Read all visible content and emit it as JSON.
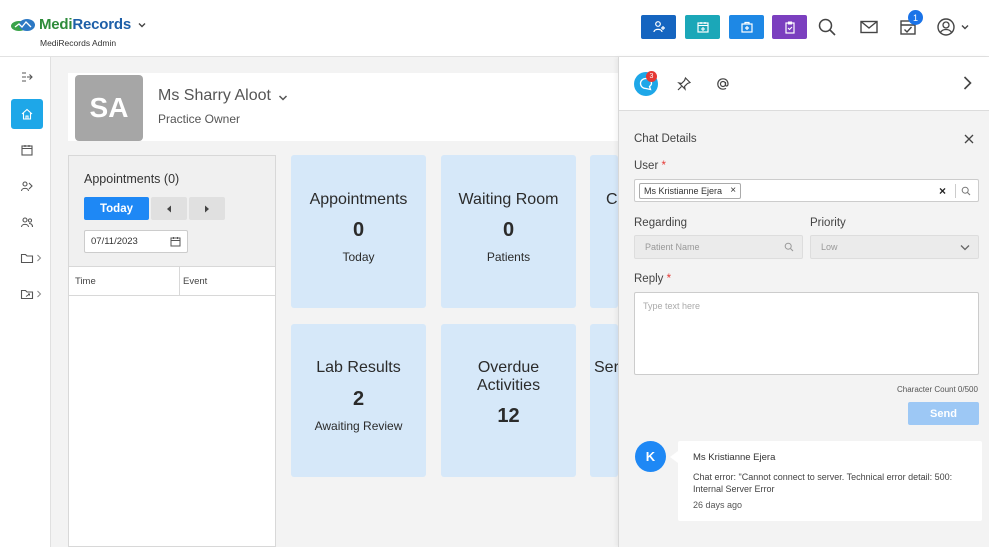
{
  "app": {
    "brand_part1": "Medi",
    "brand_part2": "Records",
    "subtitle": "MediRecords Admin",
    "brand_colors": {
      "green": "#2e8b3a",
      "blue": "#1d5fa8"
    }
  },
  "toolbar": {
    "quick_actions": [
      {
        "icon": "add-patient-icon",
        "color": "#1565c0"
      },
      {
        "icon": "calendar-add-icon",
        "color": "#1ba7b8"
      },
      {
        "icon": "medical-kit-icon",
        "color": "#1e88e5"
      },
      {
        "icon": "clipboard-icon",
        "color": "#7b3fbf"
      }
    ],
    "icons": [
      "search-icon",
      "mail-icon",
      "tasks-icon",
      "user-account-icon"
    ],
    "notification_count": "1"
  },
  "sidebar": {
    "items": [
      "expand-icon",
      "home-icon",
      "calendar-icon",
      "patients-icon",
      "contacts-icon",
      "folder-icon",
      "folder-share-icon"
    ],
    "active": "home-icon"
  },
  "profile": {
    "initials": "SA",
    "name": "Ms Sharry Aloot",
    "role": "Practice Owner"
  },
  "appointments": {
    "title": "Appointments (0)",
    "today_label": "Today",
    "date_value": "07/11/2023",
    "columns": [
      "Time",
      "Event"
    ]
  },
  "tiles": [
    {
      "title": "Appointments",
      "value": "0",
      "sub": "Today"
    },
    {
      "title": "Waiting Room",
      "value": "0",
      "sub": "Patients"
    },
    {
      "title": "Co",
      "value": "",
      "sub": ""
    },
    {
      "title": "Lab Results",
      "value": "2",
      "sub": "Awaiting Review"
    },
    {
      "title_line1": "Overdue",
      "title_line2": "Activities",
      "value": "12"
    },
    {
      "title": "Ser",
      "value": "",
      "sub": ""
    }
  ],
  "chat": {
    "unread_count": "3",
    "header": "Chat Details",
    "user_label": "User",
    "required_mark": "*",
    "selected_user": "Ms Kristianne Ejera",
    "chip_remove": "×",
    "clear_symbol": "×",
    "regarding_label": "Regarding",
    "regarding_placeholder": "Patient Name",
    "priority_label": "Priority",
    "priority_value": "Low",
    "reply_label": "Reply",
    "reply_placeholder": "Type text here",
    "char_count": "Character Count 0/500",
    "send_label": "Send",
    "message": {
      "avatar": "K",
      "author": "Ms Kristianne Ejera",
      "text": "Chat error: \"Cannot connect to server. Technical error detail: 500: Internal Server Error",
      "time": "26 days ago"
    }
  }
}
